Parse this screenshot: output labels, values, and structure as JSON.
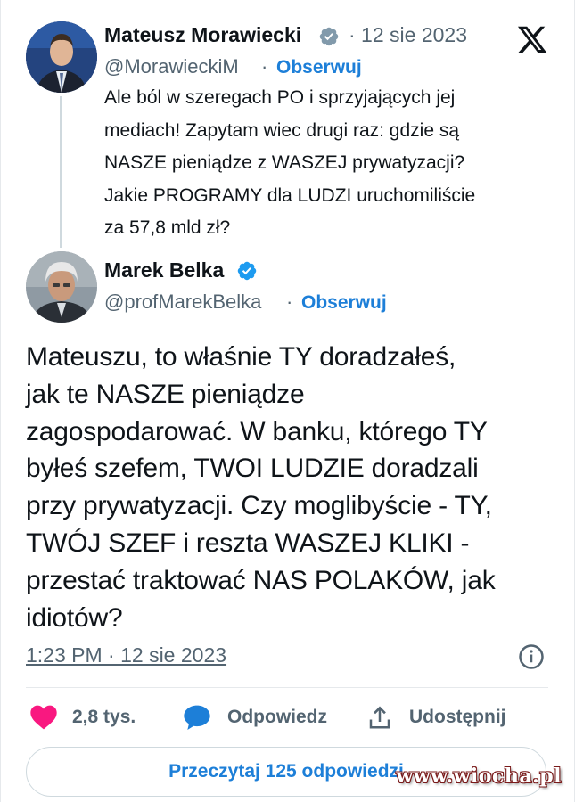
{
  "reply_tweet": {
    "author_name": "Mateusz Morawiecki",
    "date": "· 12 sie 2023",
    "handle": "@MorawieckiM",
    "separator": "·",
    "follow_label": "Obserwuj",
    "text": "Ale ból w szeregach PO i sprzyjających jej\nmediach! Zapytam wiec drugi raz: gdzie są\nNASZE pieniądze z WASZEJ prywatyzacji?\nJakie PROGRAMY dla LUDZI uruchomiliście\nza 57,8 mld zł?"
  },
  "main_tweet": {
    "author_name": "Marek Belka",
    "handle": "@profMarekBelka",
    "separator": "·",
    "follow_label": "Obserwuj",
    "text": "Mateuszu, to właśnie TY doradzałeś,\njak te NASZE pieniądze\nzagospodarować. W banku, którego TY\nbyłeś szefem, TWOI LUDZIE doradzali\nprzy prywatyzacji. Czy moglibyście - TY,\nTWÓJ SZEF i reszta WASZEJ KLIKI -\nprzestać traktować NAS POLAKÓW, jak\nidiotów?",
    "timestamp": "1:23 PM · 12 sie 2023"
  },
  "actions": {
    "likes": "2,8 tys.",
    "reply_label": "Odpowiedz",
    "share_label": "Udostępnij",
    "read_replies_label": "Przeczytaj 125 odpowiedzi"
  },
  "watermark": "www.wiocha.pl",
  "colors": {
    "accent": "#1d7fd8",
    "verified": "#1d9bf0",
    "like": "#f91880",
    "muted": "#536471"
  },
  "icons": [
    "x-logo-icon",
    "verified-badge-icon",
    "info-icon",
    "heart-icon",
    "reply-bubble-icon",
    "share-icon"
  ]
}
